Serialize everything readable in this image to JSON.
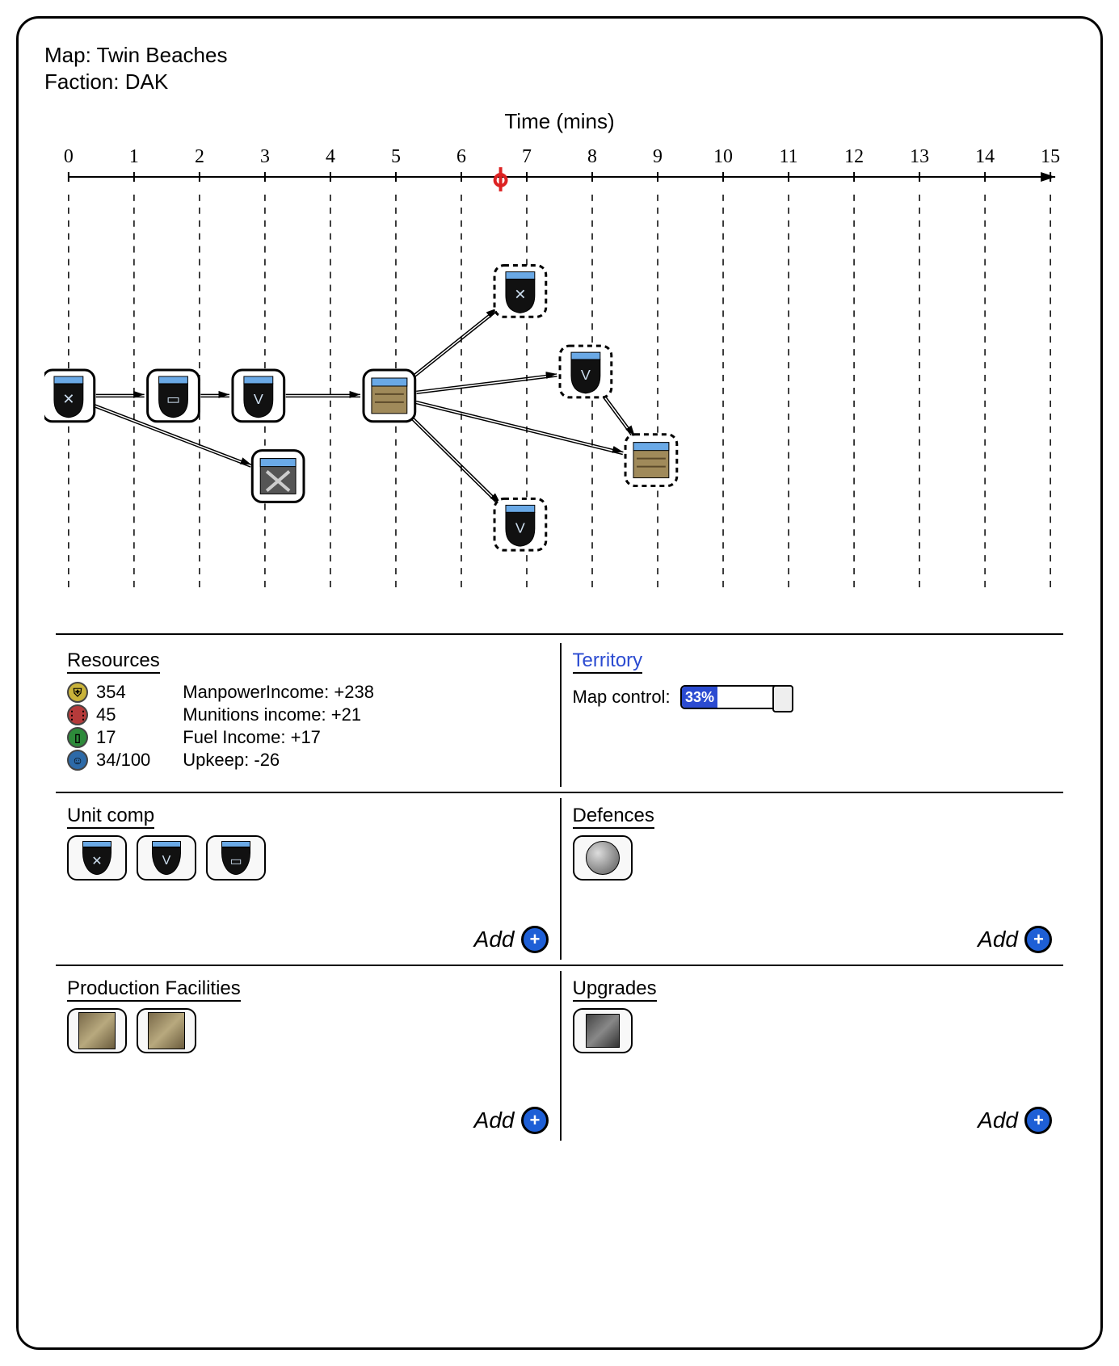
{
  "header": {
    "map_label": "Map:",
    "map_value": "Twin Beaches",
    "faction_label": "Faction:",
    "faction_value": "DAK"
  },
  "timeline": {
    "axis_title": "Time (mins)",
    "ticks": [
      0,
      1,
      2,
      3,
      4,
      5,
      6,
      7,
      8,
      9,
      10,
      11,
      12,
      13,
      14,
      15
    ],
    "current_time": 6.6,
    "nodes": [
      {
        "id": "n0",
        "t": 0,
        "row": 2,
        "kind": "shield",
        "glyph": "✕",
        "built": true
      },
      {
        "id": "n1",
        "t": 1.6,
        "row": 2,
        "kind": "shield",
        "glyph": "▭",
        "built": true
      },
      {
        "id": "n2",
        "t": 2.9,
        "row": 2,
        "kind": "shield",
        "glyph": "V",
        "built": true
      },
      {
        "id": "n3",
        "t": 3.2,
        "row": 3,
        "kind": "tool",
        "glyph": "",
        "built": true
      },
      {
        "id": "n4",
        "t": 4.9,
        "row": 2,
        "kind": "building",
        "glyph": "",
        "built": true
      },
      {
        "id": "n5",
        "t": 6.9,
        "row": 0.7,
        "kind": "shield",
        "glyph": "✕",
        "built": false
      },
      {
        "id": "n6",
        "t": 7.9,
        "row": 1.7,
        "kind": "shield",
        "glyph": "V",
        "built": false
      },
      {
        "id": "n7",
        "t": 6.9,
        "row": 3.6,
        "kind": "shield",
        "glyph": "V",
        "built": false
      },
      {
        "id": "n8",
        "t": 8.9,
        "row": 2.8,
        "kind": "building",
        "glyph": "",
        "built": false
      }
    ],
    "edges": [
      [
        "n0",
        "n1"
      ],
      [
        "n1",
        "n2"
      ],
      [
        "n0",
        "n3"
      ],
      [
        "n2",
        "n4"
      ],
      [
        "n4",
        "n5"
      ],
      [
        "n4",
        "n6"
      ],
      [
        "n4",
        "n7"
      ],
      [
        "n4",
        "n8"
      ],
      [
        "n6",
        "n8"
      ]
    ]
  },
  "resources": {
    "title": "Resources",
    "manpower": 354,
    "munitions": 45,
    "fuel": 17,
    "pop": "34/100",
    "income": {
      "manpower": {
        "label": "ManpowerIncome:",
        "value": "+238"
      },
      "munitions": {
        "label": "Munitions income:",
        "value": "+21"
      },
      "fuel": {
        "label": "Fuel Income:",
        "value": "+17"
      },
      "upkeep": {
        "label": "Upkeep:",
        "value": "-26"
      }
    }
  },
  "territory": {
    "title": "Territory",
    "map_control_label": "Map control:",
    "map_control_pct": 33
  },
  "panels": {
    "unit_comp": {
      "title": "Unit comp",
      "items": [
        "✕",
        "V",
        "▭"
      ],
      "add_label": "Add"
    },
    "defences": {
      "title": "Defences",
      "items": [
        "mine"
      ],
      "add_label": "Add"
    },
    "facilities": {
      "title": "Production Facilities",
      "items": [
        "building",
        "building"
      ],
      "add_label": "Add"
    },
    "upgrades": {
      "title": "Upgrades",
      "items": [
        "tool"
      ],
      "add_label": "Add"
    }
  },
  "icon_colors": {
    "manpower": "#c9b33a",
    "munitions": "#b53a3a",
    "fuel": "#2d8a3a",
    "pop": "#2d6aa8"
  }
}
